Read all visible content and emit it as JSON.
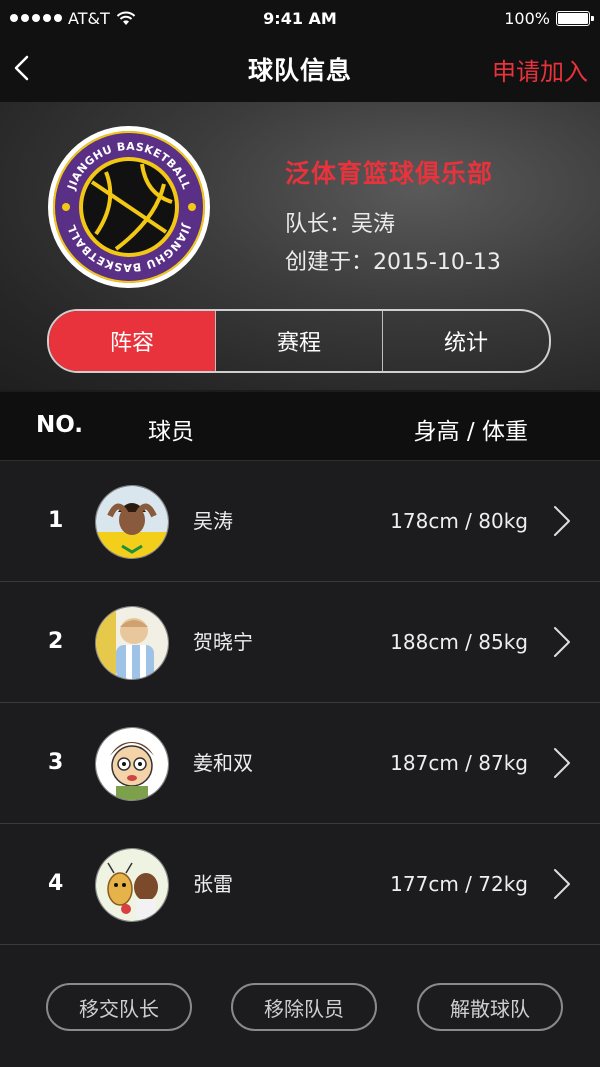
{
  "status_bar": {
    "carrier": "AT&T",
    "time": "9:41 AM",
    "battery": "100%"
  },
  "nav": {
    "title": "球队信息",
    "join_label": "申请加入"
  },
  "team": {
    "name": "泛体育篮球俱乐部",
    "captain": "队长：吴涛",
    "founded": "创建于：2015-10-13",
    "logo_text": "JIANGHU BASKETBALL"
  },
  "tabs": [
    {
      "label": "阵容",
      "active": true
    },
    {
      "label": "赛程",
      "active": false
    },
    {
      "label": "统计",
      "active": false
    }
  ],
  "table": {
    "headers": {
      "no": "NO.",
      "player": "球员",
      "height_weight": "身高 / 体重"
    },
    "rows": [
      {
        "no": "1",
        "name": "吴涛",
        "hw": "178cm / 80kg"
      },
      {
        "no": "2",
        "name": "贺晓宁",
        "hw": "188cm / 85kg"
      },
      {
        "no": "3",
        "name": "姜和双",
        "hw": "187cm / 87kg"
      },
      {
        "no": "4",
        "name": "张雷",
        "hw": "177cm / 72kg"
      }
    ]
  },
  "actions": {
    "transfer": "移交队长",
    "remove": "移除队员",
    "dissolve": "解散球队"
  },
  "colors": {
    "accent": "#e8323c",
    "logo_purple": "#5a2f86",
    "logo_gold": "#f2c815"
  }
}
